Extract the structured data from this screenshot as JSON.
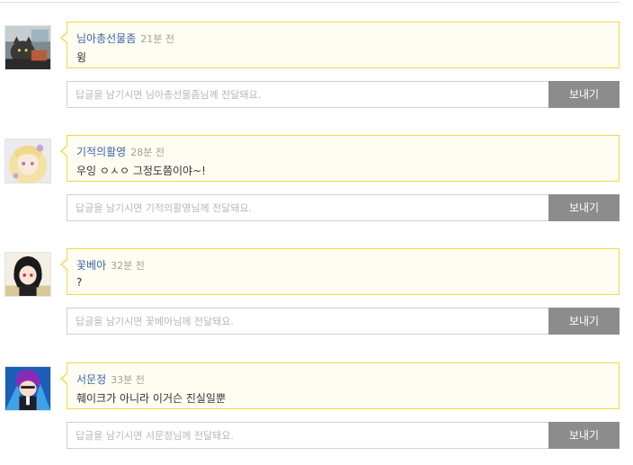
{
  "comments": [
    {
      "author": "님아총선물좀",
      "time": "21분 전",
      "message": "윙",
      "reply_placeholder": "답글을 남기시면 님아총선물좀님께 전달돼요.",
      "send_label": "보내기",
      "avatar_icon": "cat-photo-avatar"
    },
    {
      "author": "기적의활영",
      "time": "28분 전",
      "message": "우잉 ㅇㅅㅇ 그정도쯤이야~!",
      "reply_placeholder": "답글을 남기시면 기적의활영님께 전달돼요.",
      "send_label": "보내기",
      "avatar_icon": "blonde-anime-girl-avatar"
    },
    {
      "author": "꽃베아",
      "time": "32분 전",
      "message": "?",
      "reply_placeholder": "답글을 남기시면 꽃베아님께 전달돼요.",
      "send_label": "보내기",
      "avatar_icon": "dark-hair-anime-avatar"
    },
    {
      "author": "서문정",
      "time": "33분 전",
      "message": "훼이크가 아니라 이거슨 진실일뿐",
      "reply_placeholder": "답글을 남기시면 서문정님께 전달돼요.",
      "send_label": "보내기",
      "avatar_icon": "purple-hair-character-avatar"
    }
  ],
  "colors": {
    "bubble_border": "#f1d84a",
    "bubble_bg": "#fffdf2",
    "author": "#3a63a8",
    "time": "#a0a0a0",
    "send_button_bg": "#8c8c8c"
  }
}
